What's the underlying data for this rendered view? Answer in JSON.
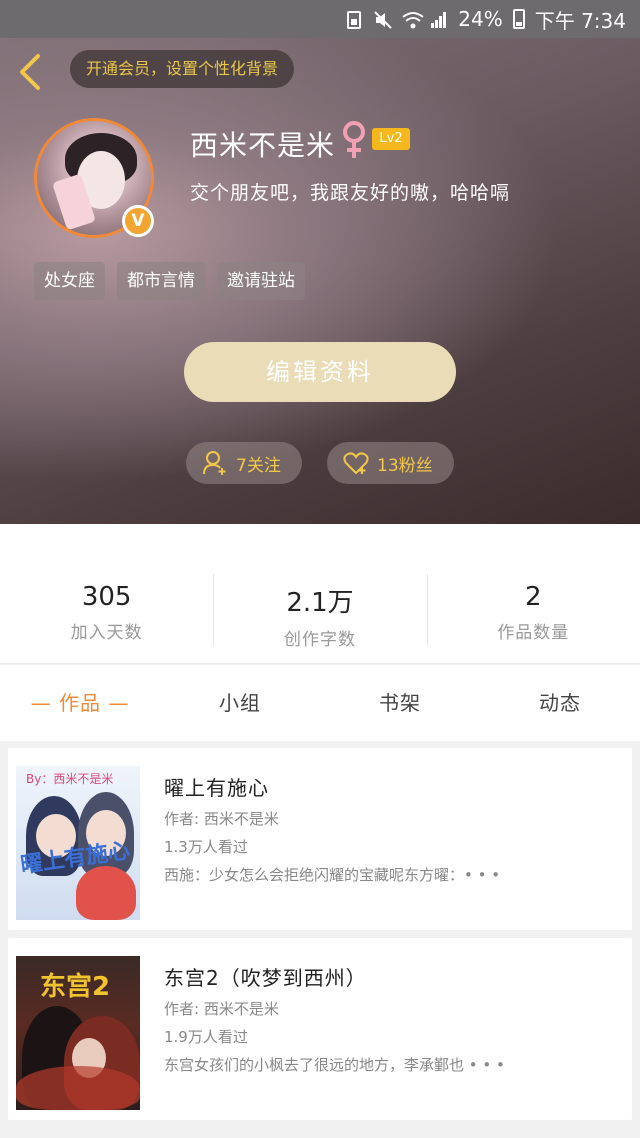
{
  "status_bar": {
    "battery": "24%",
    "time": "下午 7:34"
  },
  "header": {
    "vip_banner": "开通会员，设置个性化背景",
    "username": "西米不是米",
    "level": "Lv2",
    "bio": "交个朋友吧，我跟友好的嗷，哈哈嗝",
    "verified_badge": "V",
    "tags": [
      "处女座",
      "都市言情",
      "邀请驻站"
    ],
    "edit_button": "编辑资料",
    "following": "7关注",
    "followers": "13粉丝",
    "accent_color": "#f2c84a"
  },
  "stats": [
    {
      "value": "305",
      "label": "加入天数"
    },
    {
      "value": "2.1万",
      "label": "创作字数"
    },
    {
      "value": "2",
      "label": "作品数量"
    }
  ],
  "tabs": [
    {
      "label": "— 作品 —",
      "active": true
    },
    {
      "label": "小组",
      "active": false
    },
    {
      "label": "书架",
      "active": false
    },
    {
      "label": "动态",
      "active": false
    }
  ],
  "works": [
    {
      "title": "曜上有施心",
      "author": "作者: 西米不是米",
      "views": "1.3万人看过",
      "description": "西施：少女怎么会拒绝闪耀的宝藏呢东方曜：• • •",
      "cover_title": "曜上有施心",
      "cover_by": "By：西米不是米"
    },
    {
      "title": "东宫2（吹梦到西州）",
      "author": "作者: 西米不是米",
      "views": "1.9万人看过",
      "description": "东宫女孩们的小枫去了很远的地方，李承鄞也 • • •",
      "cover_title": "东宫2"
    }
  ]
}
